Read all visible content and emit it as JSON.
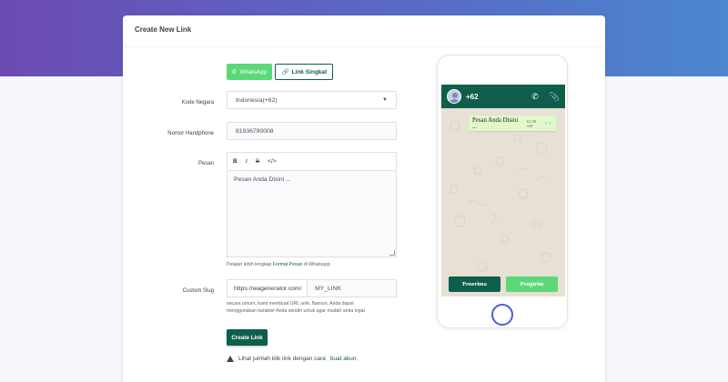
{
  "card": {
    "title": "Create New Link"
  },
  "tabs": [
    {
      "label": "WhatsApp",
      "icon": "whatsapp-icon"
    },
    {
      "label": "Link Singkat",
      "icon": "link-icon"
    }
  ],
  "form": {
    "country_label": "Kode Negara",
    "country_value": "Indonesia(+62)",
    "phone_label": "Nomor Handphone",
    "phone_value": "81936790008",
    "message_label": "Pesan",
    "toolbar": {
      "bold": "B",
      "italic": "I",
      "strike": "S",
      "code": "</>"
    },
    "message_value": "Pesan Anda Disini ...",
    "help_prefix": "Pelajari lebih lengkap",
    "help_link": "Format Pesan",
    "help_suffix": "di Whatsapp",
    "slug_label": "Custom Slug",
    "slug_prefix": "https://wagenerator.com/",
    "slug_value": "MY_LINK",
    "slug_help_1": "secara umum, kami membuat URL unik. Namun, Anda dapat",
    "slug_help_2": "menggunakan karakter Anda sendiri untuk agar mudah anda ingat",
    "submit_label": "Create Link",
    "notice_text": "Lihat jumlah klik link dengan cara",
    "notice_link": "buat akun."
  },
  "preview": {
    "contact": "+62",
    "message": "Pesan Anda Disini ...",
    "time": "11:29 AM",
    "receiver_label": "Penerima",
    "sender_label": "Pengirim"
  },
  "colors": {
    "brand_green": "#0f5e4b",
    "accent_green": "#5dd879",
    "hero_start": "#6c4bb3",
    "hero_end": "#4b86cf"
  }
}
